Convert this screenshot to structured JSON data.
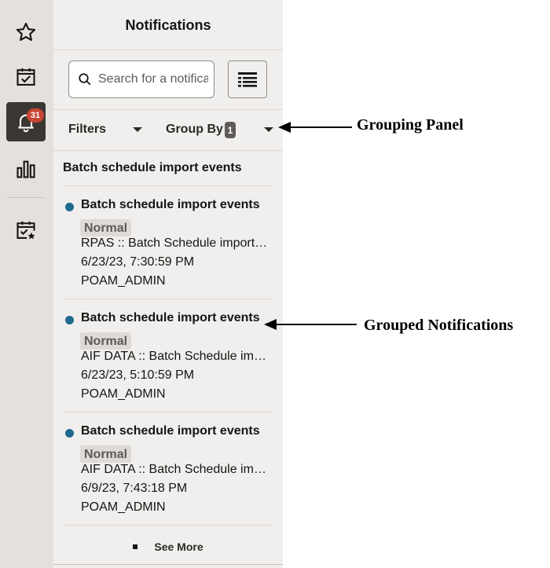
{
  "rail": {
    "notification_count": "31"
  },
  "panel": {
    "title": "Notifications",
    "search_placeholder": "Search for a notification",
    "filters_label": "Filters",
    "group_by_label": "Group By",
    "group_by_count": "1",
    "group_title": "Batch schedule import events",
    "notifications": [
      {
        "title": "Batch schedule import events",
        "priority": "Normal",
        "description": "RPAS :: Batch Schedule import event",
        "timestamp": "6/23/23, 7:30:59 PM",
        "user": "POAM_ADMIN"
      },
      {
        "title": "Batch schedule import events",
        "priority": "Normal",
        "description": "AIF DATA :: Batch Schedule import event",
        "timestamp": "6/23/23, 5:10:59 PM",
        "user": "POAM_ADMIN"
      },
      {
        "title": "Batch schedule import events",
        "priority": "Normal",
        "description": "AIF DATA :: Batch Schedule import event",
        "timestamp": "6/9/23, 7:43:18 PM",
        "user": "POAM_ADMIN"
      }
    ],
    "see_more_label": "See More"
  },
  "annotations": {
    "grouping_panel": "Grouping Panel",
    "grouped_notifications": "Grouped Notifications"
  },
  "colors": {
    "unread_dot": "#1e6b8f",
    "badge": "#c74634",
    "rail_active": "#3a3632"
  }
}
